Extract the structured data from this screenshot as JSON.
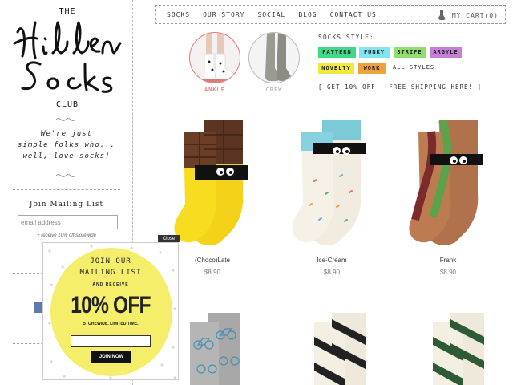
{
  "logo": {
    "the": "THE",
    "script": "Hidden Socks",
    "club": "CLUB"
  },
  "sidebar": {
    "tagline": [
      "We're just",
      "simple folks who...",
      "well, love socks!"
    ],
    "mailing_title": "Join Mailing List",
    "email_placeholder": "email address",
    "mailing_note": "+ receive 10% off storewide"
  },
  "nav": {
    "items": [
      "SOCKS",
      "OUR STORY",
      "SOCIAL",
      "BLOG",
      "CONTACT US"
    ],
    "cart_label": "MY CART",
    "cart_count": "(0)"
  },
  "categories": [
    {
      "label": "ANKLE",
      "active": true
    },
    {
      "label": "CREW",
      "active": false
    }
  ],
  "styles": {
    "title": "SOCKS STYLE:",
    "tags": [
      {
        "label": "PATTERN",
        "color": "#3fd98a"
      },
      {
        "label": "FUNKY",
        "color": "#7fe6f0"
      },
      {
        "label": "STRIPE",
        "color": "#8ee06a"
      },
      {
        "label": "ARGYLE",
        "color": "#c77ed6"
      },
      {
        "label": "NOVELTY",
        "color": "#f1ea3c"
      },
      {
        "label": "WORK",
        "color": "#f0a23a"
      }
    ],
    "all_label": "ALL STYLES",
    "promo": "[ GET 10% OFF + FREE SHIPPING HERE! ]"
  },
  "products": [
    {
      "name": "(Choco)Late",
      "price": "$8.90"
    },
    {
      "name": "Ice-Cream",
      "price": "$8.90"
    },
    {
      "name": "Frank",
      "price": "$8.90"
    }
  ],
  "popup": {
    "close_label": "Close",
    "line1": "JOIN OUR",
    "line2": "MAILING LIST",
    "line3": "AND RECEIVE",
    "headline": "10% OFF",
    "line5": "STOREWIDE. LIMITED TIME.",
    "button": "JOIN NOW"
  },
  "colors": {
    "accent": "#e05a5a",
    "popup_yellow": "#f4ee6a"
  }
}
